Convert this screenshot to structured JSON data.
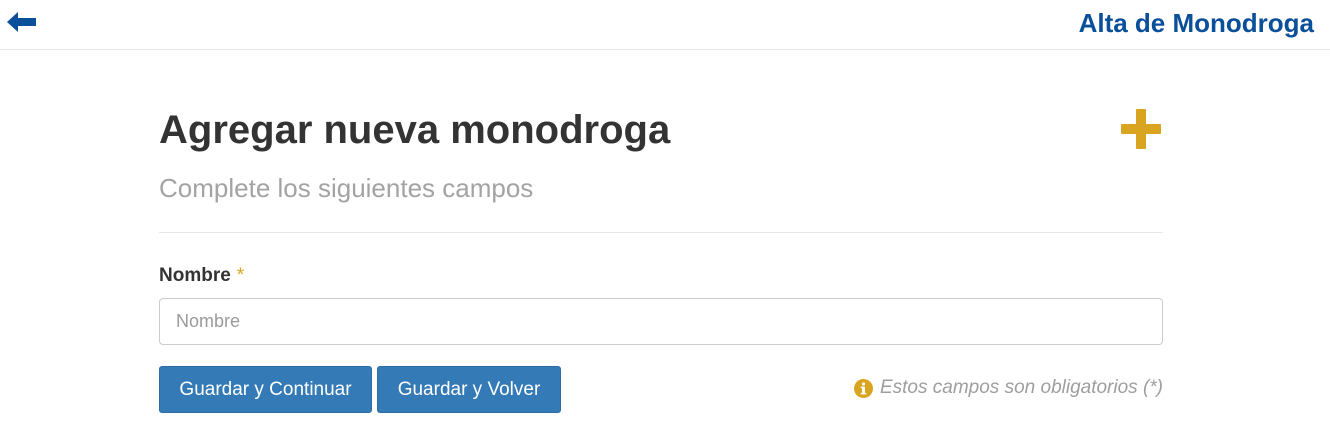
{
  "header": {
    "back_icon": "arrow-left-icon",
    "title": "Alta de Monodroga",
    "title_color": "#0a4f9a"
  },
  "form": {
    "title": "Agregar nueva monodroga",
    "add_icon": "plus-icon",
    "add_icon_color": "#d9a520",
    "subtitle": "Complete los siguientes campos",
    "name_label": "Nombre",
    "required_mark": "*",
    "name_placeholder": "Nombre",
    "name_value": "",
    "save_continue_label": "Guardar y Continuar",
    "save_back_label": "Guardar y Volver",
    "button_color": "#337ab7",
    "info_icon": "info-circle-icon",
    "required_note": "Estos campos son obligatorios (*)"
  }
}
